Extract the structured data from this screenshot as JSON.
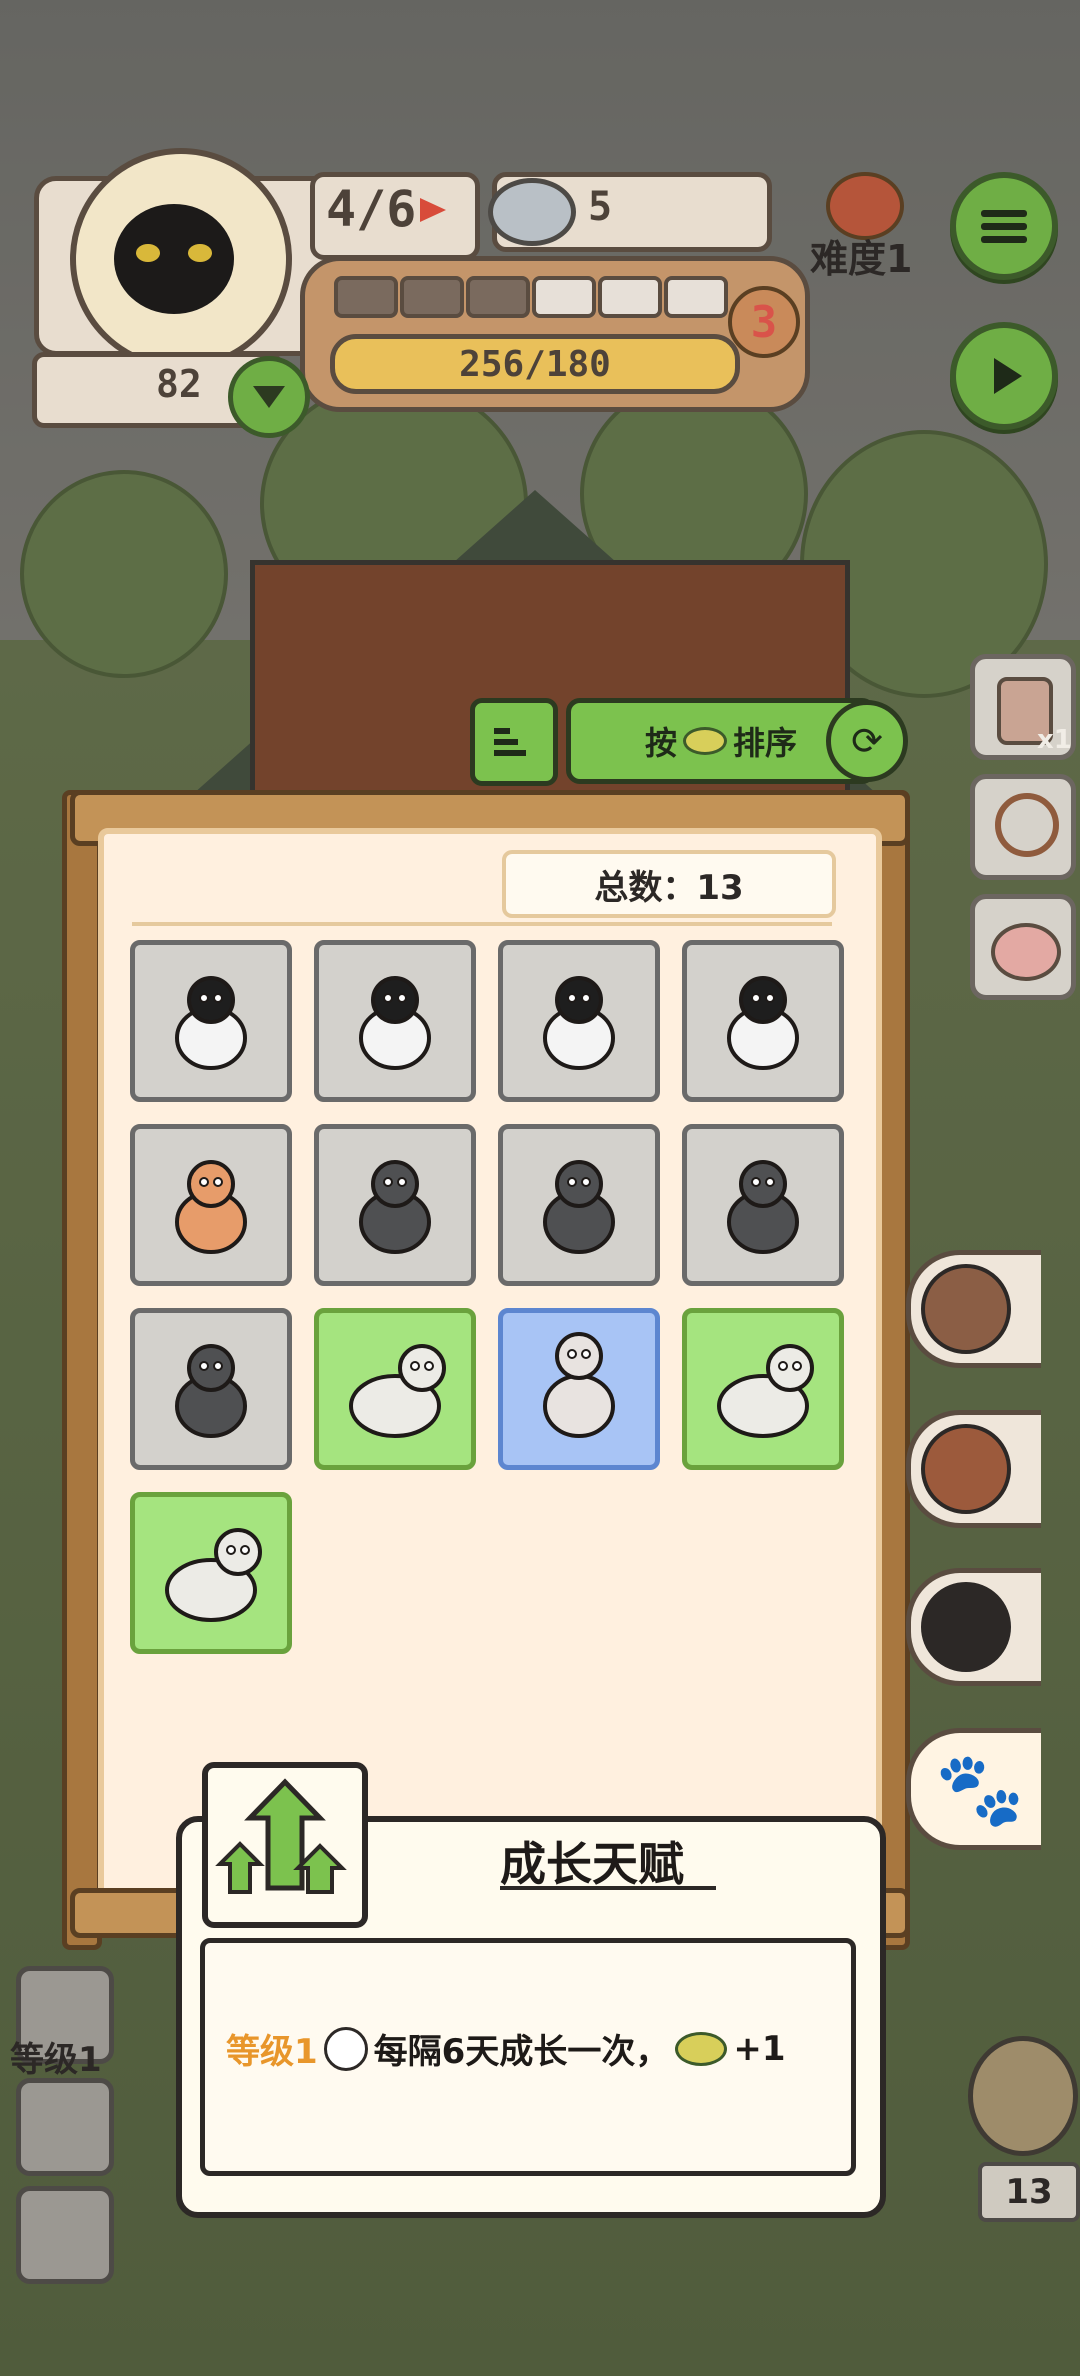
{
  "hud": {
    "wave": "4/6",
    "food": "5",
    "difficulty": "难度1",
    "level_num": "3",
    "exp": "256/180",
    "hp": "82",
    "progress_filled": 3,
    "progress_total": 6
  },
  "sort": {
    "label_prefix": "按",
    "label_suffix": "排序"
  },
  "panel": {
    "total": "总数：13",
    "cards": [
      {
        "animal": "border-collie",
        "rarity": "gray"
      },
      {
        "animal": "border-collie",
        "rarity": "gray"
      },
      {
        "animal": "border-collie",
        "rarity": "gray"
      },
      {
        "animal": "border-collie",
        "rarity": "gray"
      },
      {
        "animal": "fox",
        "rarity": "gray"
      },
      {
        "animal": "wolf",
        "rarity": "gray"
      },
      {
        "animal": "wolf",
        "rarity": "gray"
      },
      {
        "animal": "wolf",
        "rarity": "gray"
      },
      {
        "animal": "wolf",
        "rarity": "gray"
      },
      {
        "animal": "goat",
        "rarity": "green"
      },
      {
        "animal": "alpaca",
        "rarity": "blue"
      },
      {
        "animal": "goat",
        "rarity": "green"
      },
      {
        "animal": "goat",
        "rarity": "green"
      }
    ]
  },
  "talent": {
    "title": "成长天赋",
    "level": "等级1",
    "desc": "每隔6天成长一次，",
    "bonus": "+1"
  },
  "left": {
    "level_label": "等级1"
  },
  "right": {
    "item_badge": "x1",
    "bottom_count": "13"
  },
  "colors": {
    "accent_green": "#6fae45",
    "gray_card": "#d3d1cc",
    "green_card": "#a5e47f",
    "blue_card": "#a8c4f5",
    "talent_level": "#e8962b"
  }
}
